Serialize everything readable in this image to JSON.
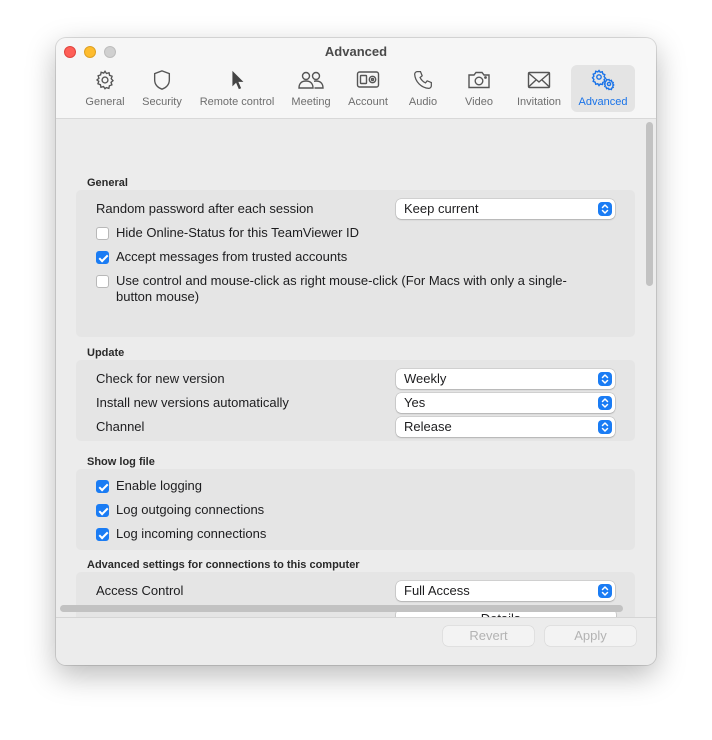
{
  "window": {
    "title": "Advanced"
  },
  "toolbar": {
    "items": [
      {
        "label": "General",
        "icon": "gear-icon"
      },
      {
        "label": "Security",
        "icon": "shield-icon"
      },
      {
        "label": "Remote control",
        "icon": "cursor-icon"
      },
      {
        "label": "Meeting",
        "icon": "people-icon"
      },
      {
        "label": "Account",
        "icon": "id-card-icon"
      },
      {
        "label": "Audio",
        "icon": "phone-icon"
      },
      {
        "label": "Video",
        "icon": "camera-icon"
      },
      {
        "label": "Invitation",
        "icon": "envelope-icon"
      },
      {
        "label": "Advanced",
        "icon": "gears-icon"
      }
    ],
    "active": "Advanced"
  },
  "general": {
    "title": "General",
    "random_password_label": "Random password after each session",
    "random_password_value": "Keep current",
    "hide_status_label": "Hide Online-Status for this TeamViewer ID",
    "hide_status_checked": false,
    "accept_messages_label": "Accept messages from trusted accounts",
    "accept_messages_checked": true,
    "right_click_label_line1": "Use control and mouse-click as right mouse-click (For Macs with only a single-",
    "right_click_label_line2": "button mouse)",
    "right_click_checked": false
  },
  "update": {
    "title": "Update",
    "check_label": "Check for new version",
    "check_value": "Weekly",
    "install_label": "Install new versions automatically",
    "install_value": "Yes",
    "channel_label": "Channel",
    "channel_value": "Release"
  },
  "log": {
    "title": "Show log file",
    "enable_label": "Enable logging",
    "enable_checked": true,
    "outgoing_label": "Log outgoing connections",
    "outgoing_checked": true,
    "incoming_label": "Log incoming connections",
    "incoming_checked": true
  },
  "advanced_connections": {
    "title": "Advanced settings for connections to this computer",
    "access_label": "Access Control",
    "access_value": "Full Access",
    "details_label": "Details..."
  },
  "footer": {
    "revert_label": "Revert",
    "apply_label": "Apply"
  },
  "colors": {
    "accent": "#1a7cf4",
    "active_label": "#1a73e8"
  }
}
